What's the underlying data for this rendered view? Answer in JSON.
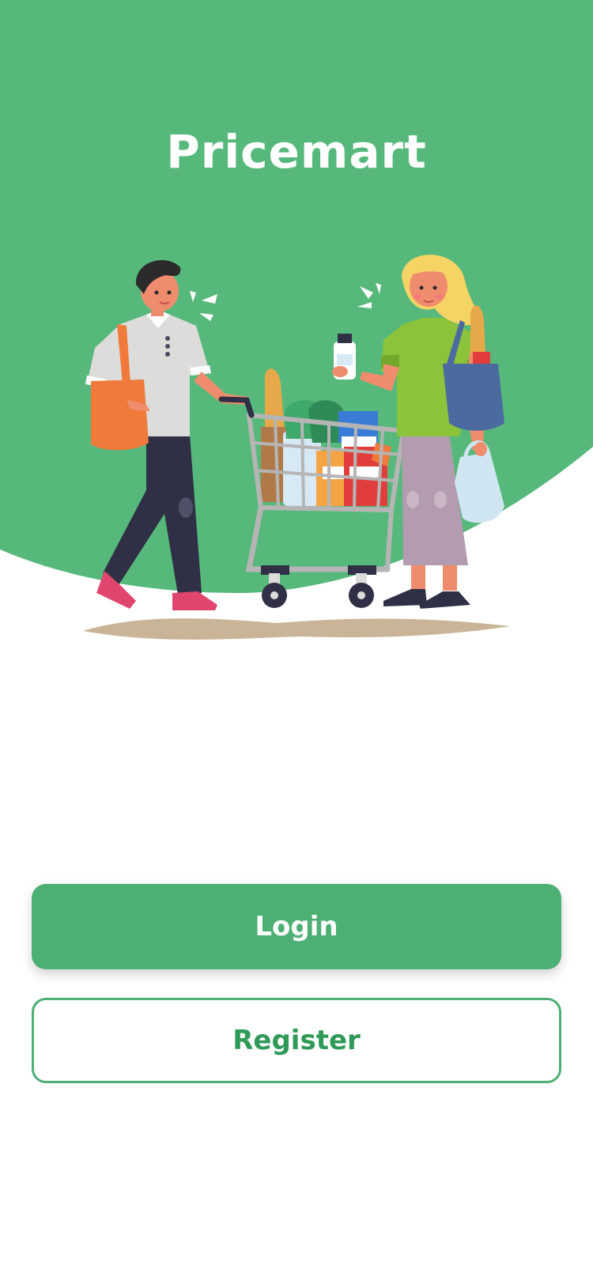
{
  "app": {
    "title": "Pricemart"
  },
  "hero": {
    "illustration": "couple-shopping-with-grocery-cart"
  },
  "actions": {
    "login_label": "Login",
    "register_label": "Register"
  },
  "colors": {
    "brand_green": "#56b97b",
    "button_green": "#4caf73",
    "register_text": "#2f9a57",
    "background": "#ffffff"
  }
}
